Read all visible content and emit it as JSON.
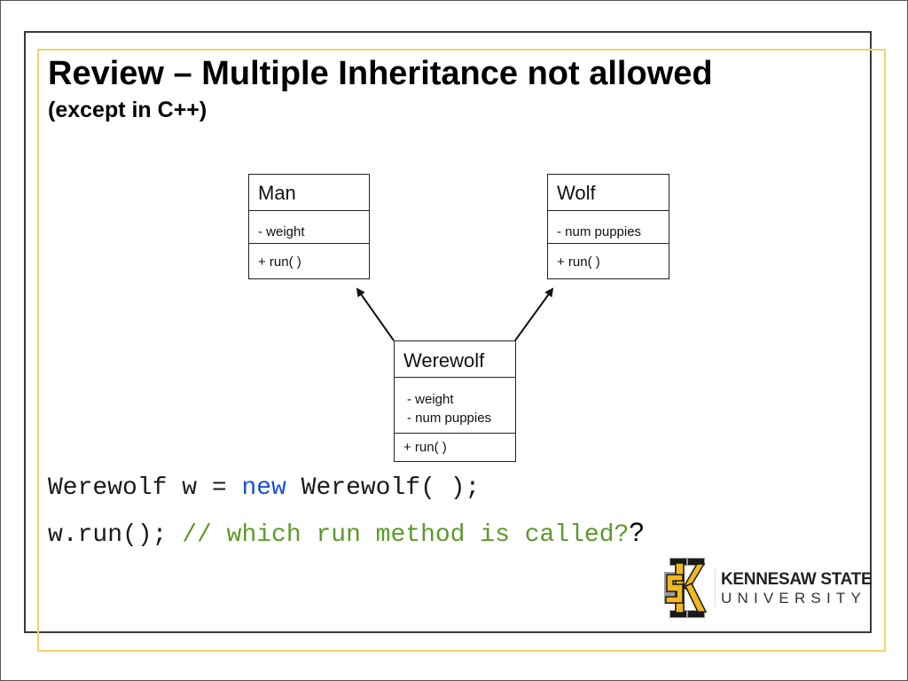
{
  "slide": {
    "title": "Review – Multiple Inheritance not allowed",
    "subtitle": "(except in C++)"
  },
  "diagram": {
    "classes": [
      {
        "id": "man",
        "name": "Man",
        "attributes": [
          "- weight"
        ],
        "methods": [
          "+ run( )"
        ]
      },
      {
        "id": "wolf",
        "name": "Wolf",
        "attributes": [
          "- num puppies"
        ],
        "methods": [
          "+ run( )"
        ]
      },
      {
        "id": "werewolf",
        "name": "Werewolf",
        "attributes": [
          "- weight",
          "- num puppies"
        ],
        "methods": [
          "+ run( )"
        ]
      }
    ],
    "relations": [
      {
        "from": "Werewolf",
        "to": "Man",
        "type": "inheritance"
      },
      {
        "from": "Werewolf",
        "to": "Wolf",
        "type": "inheritance"
      }
    ]
  },
  "code": {
    "line1": {
      "part1": "Werewolf w = ",
      "keyword": "new",
      "part2": " Werewolf( );"
    },
    "line2": {
      "statement": "w.run(); ",
      "comment": "// which run method is called?",
      "trailing": "?"
    }
  },
  "logo": {
    "line1": "KENNESAW STATE",
    "line2": "UNIVERSITY",
    "icon": "ks-monogram-icon"
  },
  "colors": {
    "accent_gold": "#f3d26b",
    "keyword_blue": "#1a4fd6",
    "comment_green": "#5b9a2a",
    "logo_gold": "#f2b81f"
  }
}
